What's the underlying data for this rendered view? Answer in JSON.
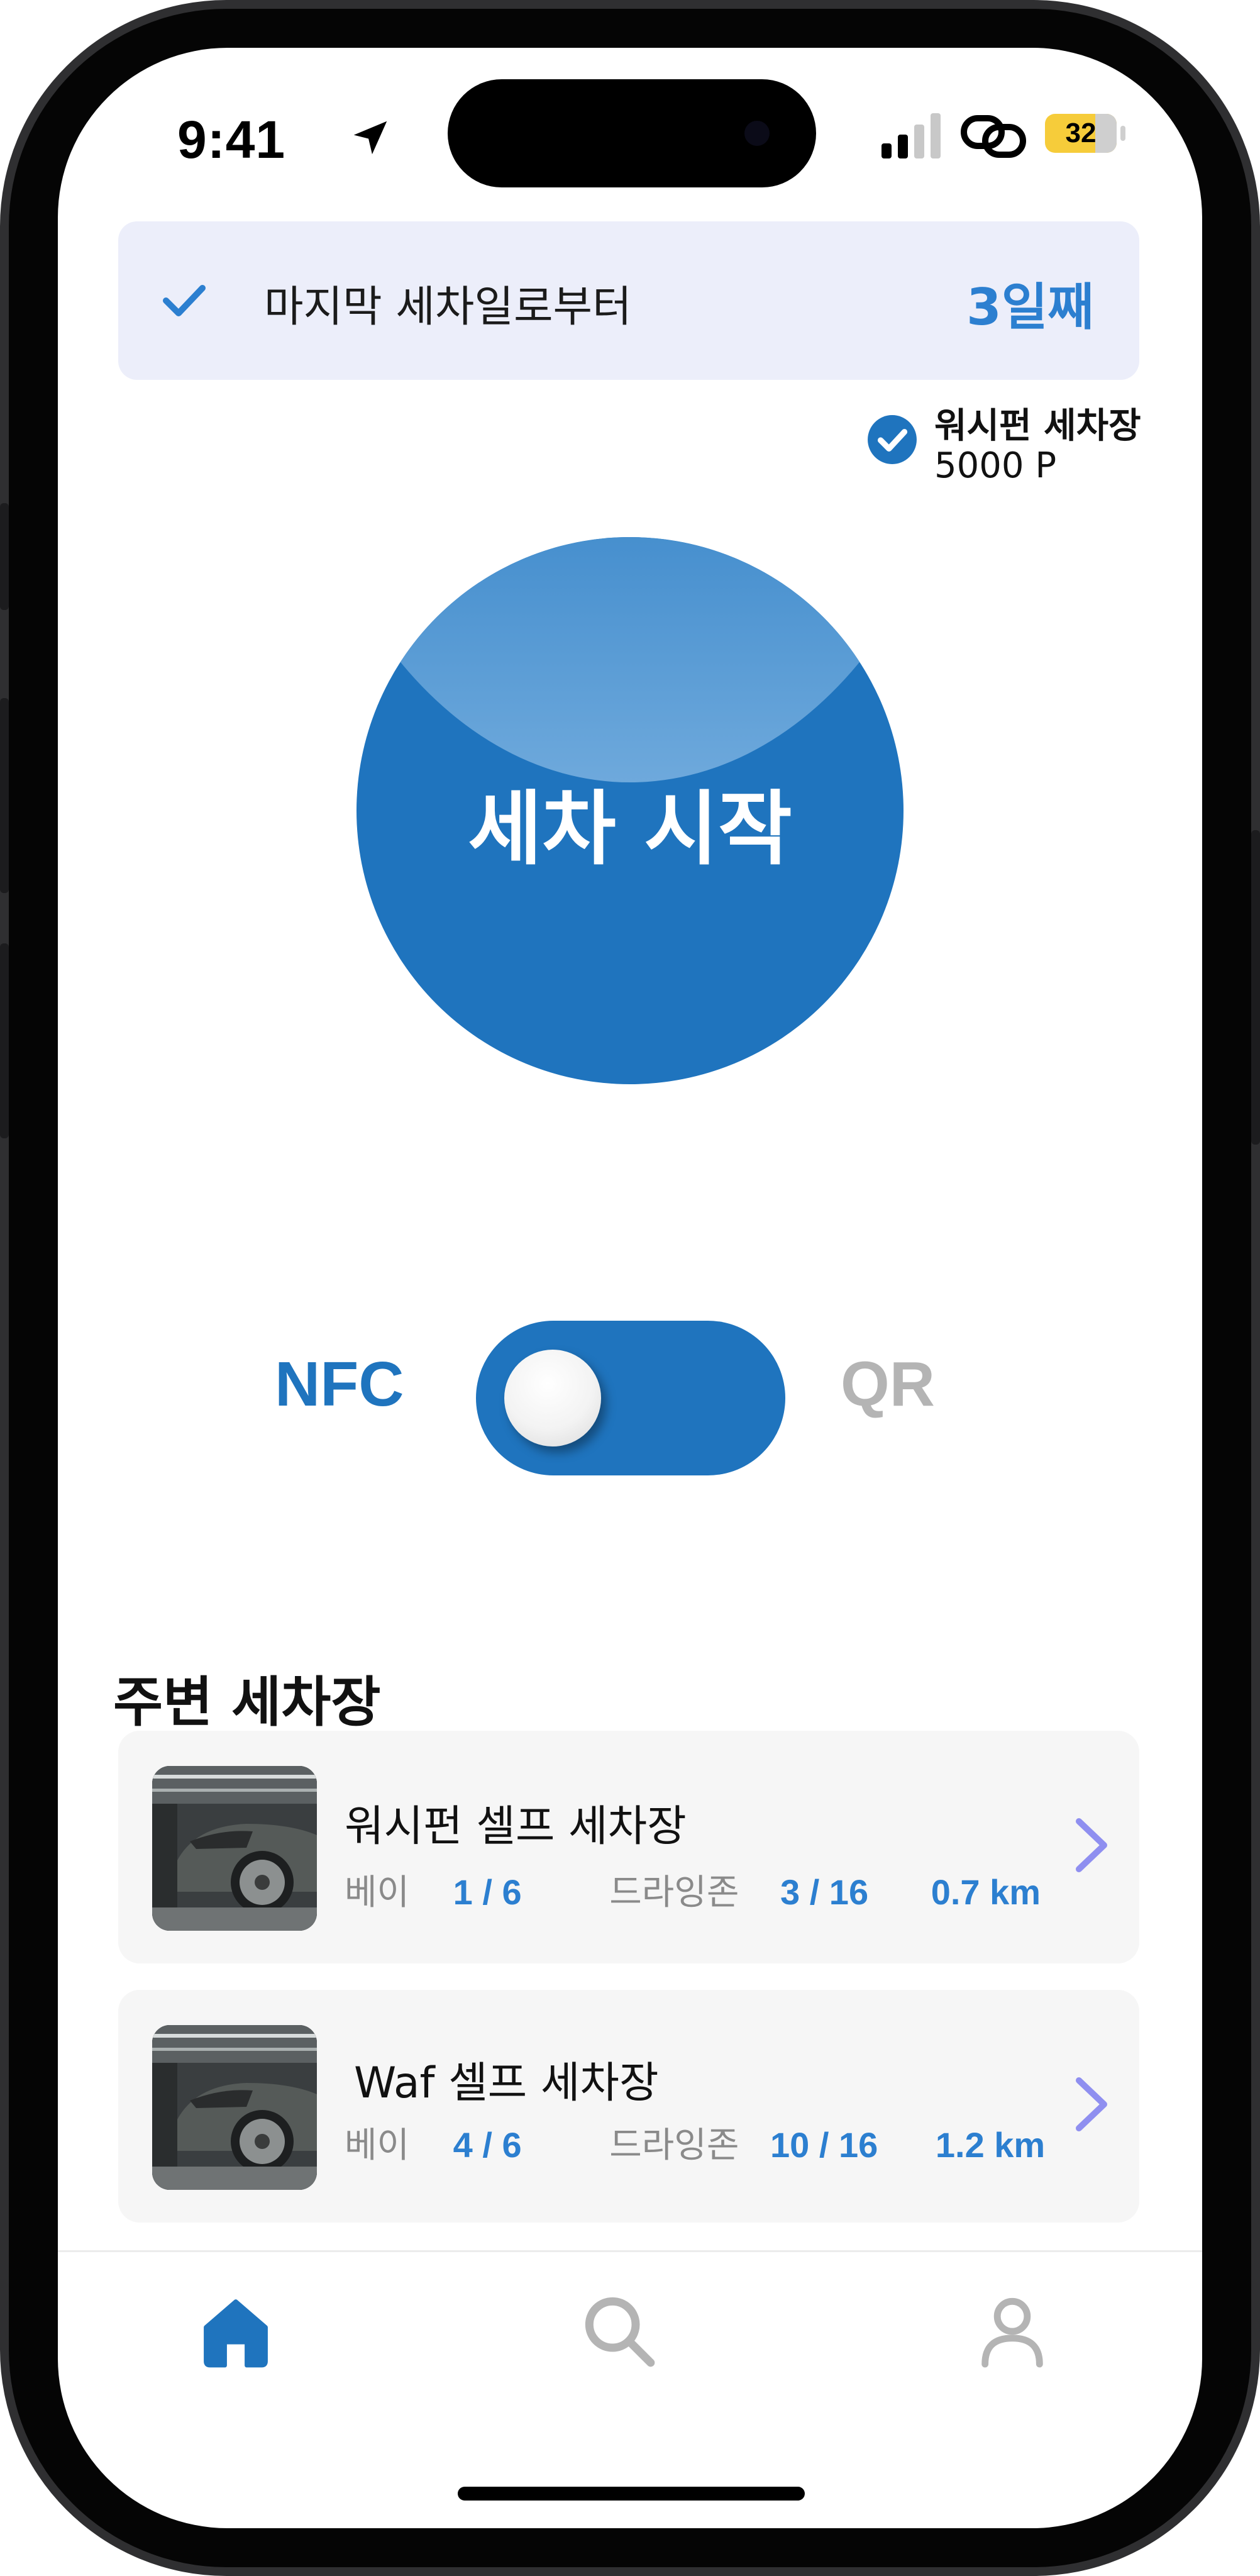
{
  "status_bar": {
    "time": "9:41",
    "battery": "32",
    "icons": [
      "location-arrow-icon",
      "cellular-signal-icon",
      "link-icon",
      "battery-icon"
    ]
  },
  "banner": {
    "icon": "check-icon",
    "text": "마지막 세차일로부터",
    "days": "3일째"
  },
  "selected_wash": {
    "icon": "check-circle-icon",
    "name": "워시펀 세차장",
    "points": "5000 P"
  },
  "start_button": {
    "label": "세차 시작"
  },
  "mode_toggle": {
    "left_label": "NFC",
    "right_label": "QR",
    "selected": "NFC"
  },
  "nearby": {
    "title": "주변 세차장",
    "items": [
      {
        "name": "워시펀 셀프 세차장",
        "bay_label": "베이",
        "bay_value": "1 / 6",
        "dry_label": "드라잉존",
        "dry_value": "3 / 16",
        "distance": "0.7 km"
      },
      {
        "name": "Waf 셀프 세차장",
        "bay_label": "베이",
        "bay_value": "4 / 6",
        "dry_label": "드라잉존",
        "dry_value": "10 / 16",
        "distance": "1.2 km"
      }
    ]
  },
  "tab_bar": {
    "tabs": [
      {
        "icon": "home-icon",
        "active": true
      },
      {
        "icon": "search-icon",
        "active": false
      },
      {
        "icon": "user-icon",
        "active": false
      }
    ]
  },
  "colors": {
    "accent": "#1f74be",
    "accent_text": "#2c7fd0",
    "banner_bg": "#eceefa",
    "card_bg": "#f6f6f6",
    "chevron": "#8f8ff0",
    "inactive": "#b4b4b4"
  }
}
